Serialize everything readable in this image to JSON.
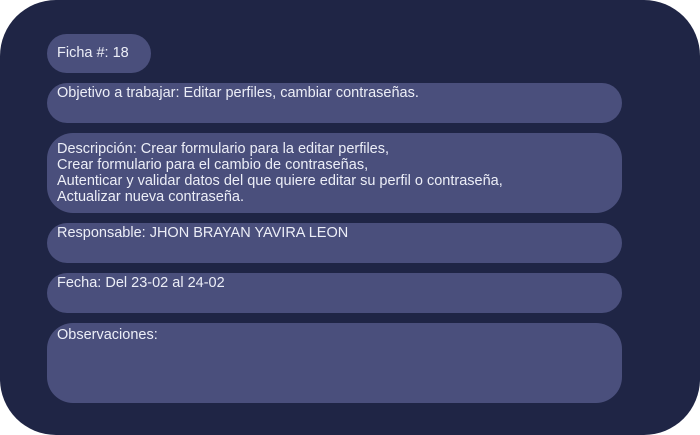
{
  "colors": {
    "card_background": "#1f2545",
    "field_background": "#4a4f7c",
    "text": "#eceef7"
  },
  "ficha": {
    "label": "Ficha #: 18"
  },
  "fields": {
    "objetivo": "Objetivo a trabajar: Editar perfiles, cambiar contraseñas.",
    "descripcion": "Descripción: Crear formulario para la editar  perfiles,\nCrear formulario para  el cambio de contraseñas,\nAutenticar y validar datos del que quiere editar su perfil o contraseña,\nActualizar nueva  contraseña.",
    "responsable": "Responsable: JHON BRAYAN YAVIRA LEON",
    "fecha": "Fecha: Del 23-02 al 24-02",
    "observaciones": "Observaciones:"
  }
}
